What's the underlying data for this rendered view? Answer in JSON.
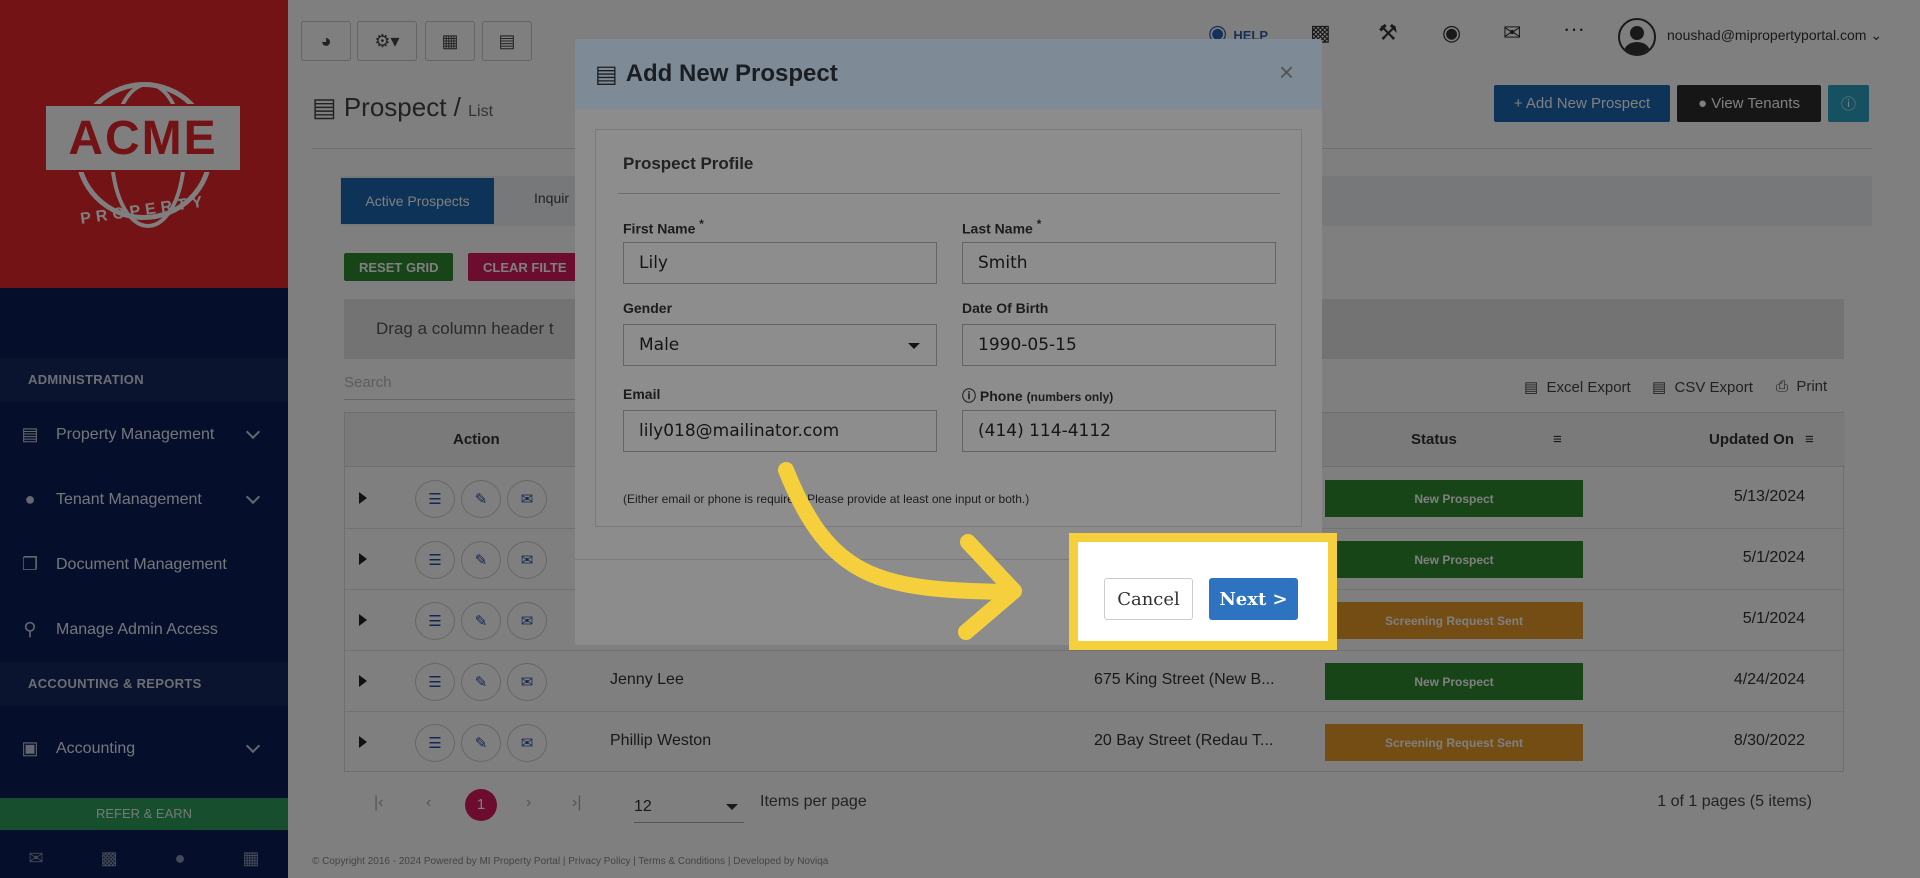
{
  "sidebar": {
    "logo_text": "ACME",
    "logo_sub": "PROPERTY",
    "section_admin": "ADMINISTRATION",
    "items_admin": [
      {
        "label": "Property Management",
        "icon": "building-icon"
      },
      {
        "label": "Tenant Management",
        "icon": "users-icon"
      },
      {
        "label": "Document Management",
        "icon": "documents-icon"
      },
      {
        "label": "Manage Admin Access",
        "icon": "key-icon"
      }
    ],
    "section_accounting": "ACCOUNTING & REPORTS",
    "accounting_label": "Accounting",
    "refer_label": "REFER & EARN"
  },
  "topbar": {
    "help_label": "HELP",
    "user_email": "noushad@mipropertyportal.com"
  },
  "page": {
    "title": "Prospect",
    "separator": "/",
    "subtitle": "List",
    "add_button": "+ Add New Prospect",
    "view_tenants_button": "View Tenants",
    "tab_active": "Active Prospects",
    "tab_2": "Inquir",
    "reset_grid": "RESET GRID",
    "clear_filter": "CLEAR FILTE",
    "group_hint": "Drag a column header t",
    "search_placeholder": "Search",
    "excel_export": "Excel Export",
    "csv_export": "CSV Export",
    "print": "Print"
  },
  "grid": {
    "headers": {
      "action": "Action",
      "status": "Status",
      "updated_on": "Updated On"
    },
    "rows": [
      {
        "name": "",
        "address": "",
        "status": "New Prospect",
        "status_color": "#2f8a2f",
        "date": "5/13/2024"
      },
      {
        "name": "",
        "address": "",
        "status": "New Prospect",
        "status_color": "#2f8a2f",
        "date": "5/1/2024"
      },
      {
        "name": "",
        "address": "",
        "status": "Screening Request Sent",
        "status_color": "#e69a28",
        "date": "5/1/2024"
      },
      {
        "name": "Jenny Lee",
        "address": "675 King Street (New B...",
        "status": "New Prospect",
        "status_color": "#2f8a2f",
        "date": "4/24/2024"
      },
      {
        "name": "Phillip Weston",
        "address": "20 Bay Street (Redau T...",
        "status": "Screening Request Sent",
        "status_color": "#e69a28",
        "date": "8/30/2022"
      }
    ],
    "pager": {
      "current_page": "1",
      "page_size": "12",
      "items_per_page": "Items per page",
      "summary": "1 of 1 pages (5 items)"
    }
  },
  "footer": {
    "text": "© Copyright 2016 - 2024 Powered by MI Property Portal | Privacy Policy | Terms & Conditions | Developed by Noviqa"
  },
  "modal": {
    "title": "Add New Prospect",
    "close": "×",
    "card_title": "Prospect Profile",
    "first_name_label": "First Name",
    "first_name_value": "Lily",
    "last_name_label": "Last Name",
    "last_name_value": "Smith",
    "required_mark": "*",
    "gender_label": "Gender",
    "gender_value": "Male",
    "dob_label": "Date Of Birth",
    "dob_value": "1990-05-15",
    "email_label": "Email",
    "email_value": "lily018@mailinator.com",
    "phone_label": "Phone",
    "phone_hint": "(numbers only)",
    "phone_value": "(414) 114-4112",
    "note": "(Either email or phone is required. Please provide at least one input or both.)",
    "cancel_label": "Cancel",
    "next_label": "Next >"
  },
  "colors": {
    "sidebar_bg": "#0b1e57",
    "logo_bg": "#e8262b",
    "primary": "#1b67b1",
    "highlight": "#f6d03c",
    "new_prospect": "#2f8a2f",
    "screening": "#e69a28"
  }
}
